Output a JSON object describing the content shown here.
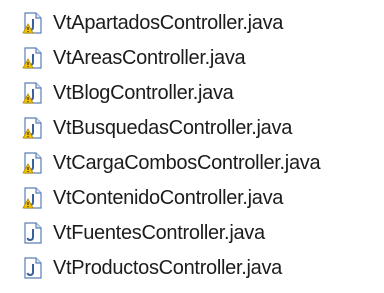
{
  "package_explorer": {
    "files": [
      {
        "name": "VtApartadosController.java",
        "icon": "java-file-warning-icon",
        "has_warning": true
      },
      {
        "name": "VtAreasController.java",
        "icon": "java-file-warning-icon",
        "has_warning": true
      },
      {
        "name": "VtBlogController.java",
        "icon": "java-file-warning-icon",
        "has_warning": true
      },
      {
        "name": "VtBusquedasController.java",
        "icon": "java-file-warning-icon",
        "has_warning": true
      },
      {
        "name": "VtCargaCombosController.java",
        "icon": "java-file-warning-icon",
        "has_warning": true
      },
      {
        "name": "VtContenidoController.java",
        "icon": "java-file-warning-icon",
        "has_warning": true
      },
      {
        "name": "VtFuentesController.java",
        "icon": "java-file-icon",
        "has_warning": false
      },
      {
        "name": "VtProductosController.java",
        "icon": "java-file-icon",
        "has_warning": false
      }
    ]
  },
  "colors": {
    "java_icon_blue": "#5b7fb8",
    "warning_yellow": "#f5c400",
    "text": "#1c1c1c"
  }
}
